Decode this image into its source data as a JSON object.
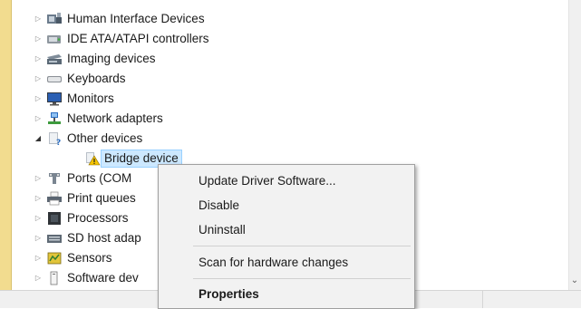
{
  "tree": {
    "items": [
      {
        "label": "Human Interface Devices",
        "icon": "hid-icon",
        "expanded": false
      },
      {
        "label": "IDE ATA/ATAPI controllers",
        "icon": "ide-controller-icon",
        "expanded": false
      },
      {
        "label": "Imaging devices",
        "icon": "scanner-icon",
        "expanded": false
      },
      {
        "label": "Keyboards",
        "icon": "keyboard-icon",
        "expanded": false
      },
      {
        "label": "Monitors",
        "icon": "monitor-icon",
        "expanded": false
      },
      {
        "label": "Network adapters",
        "icon": "network-adapter-icon",
        "expanded": false
      },
      {
        "label": "Other devices",
        "icon": "other-devices-icon",
        "expanded": true
      },
      {
        "label": "Bridge device",
        "icon": "warning-device-icon",
        "child": true,
        "selected": true
      },
      {
        "label": "Ports (COM",
        "icon": "port-icon",
        "expanded": false
      },
      {
        "label": "Print queues",
        "icon": "printer-icon",
        "expanded": false
      },
      {
        "label": "Processors",
        "icon": "processor-icon",
        "expanded": false
      },
      {
        "label": "SD host adap",
        "icon": "sd-host-icon",
        "expanded": false
      },
      {
        "label": "Sensors",
        "icon": "sensor-icon",
        "expanded": false
      },
      {
        "label": "Software dev",
        "icon": "software-device-icon",
        "expanded": false
      }
    ]
  },
  "context_menu": {
    "items": [
      {
        "label": "Update Driver Software..."
      },
      {
        "label": "Disable"
      },
      {
        "label": "Uninstall"
      },
      {
        "label": "Scan for hardware changes"
      },
      {
        "label": "Properties"
      }
    ]
  },
  "colors": {
    "accent": "#f2dc8f",
    "selection": "#cce8ff"
  }
}
